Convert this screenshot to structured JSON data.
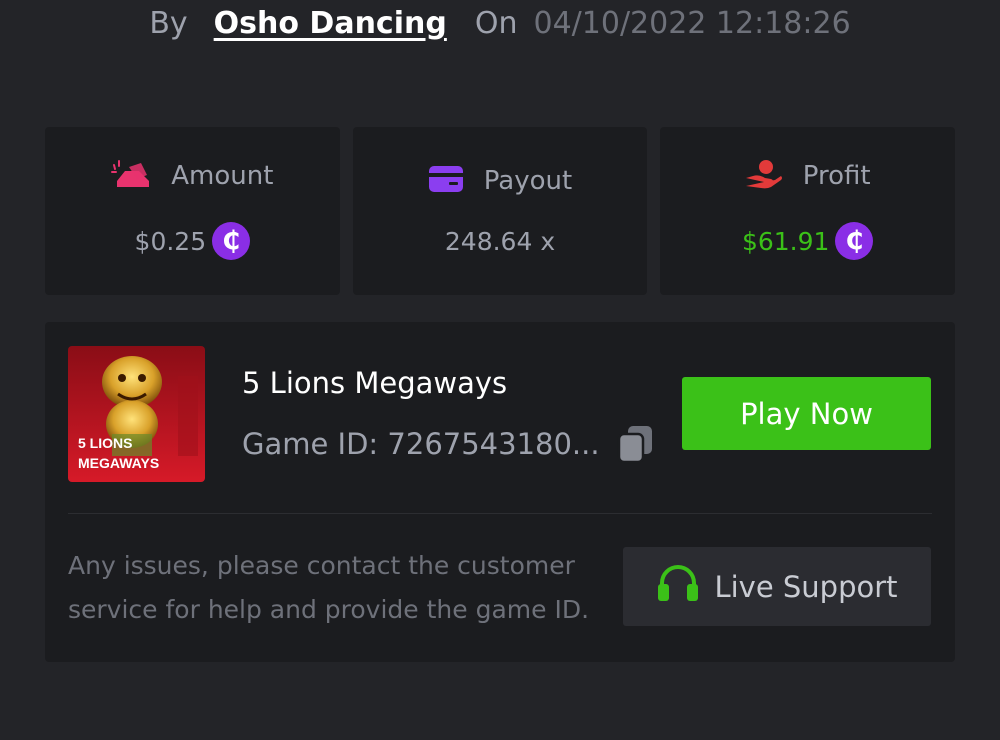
{
  "byline": {
    "by_label": "By",
    "username": "Osho Dancing",
    "on_label": "On",
    "datetime": "04/10/2022 12:18:26"
  },
  "stats": [
    {
      "icon": "bet-amount-icon",
      "label": "Amount",
      "value": "$0.25",
      "coin": "₵",
      "value_color": "#9ea2ad"
    },
    {
      "icon": "card-icon",
      "label": "Payout",
      "value": "248.64 x",
      "value_color": "#9ea2ad"
    },
    {
      "icon": "profit-hand-icon",
      "label": "Profit",
      "value": "$61.91",
      "coin": "₵",
      "value_color": "#3bc118"
    }
  ],
  "game": {
    "title": "5 Lions Megaways",
    "id_text": "Game ID: 7267543180...",
    "thumb_text_line1": "5 LIONS",
    "thumb_text_line2": "MEGAWAYS",
    "play_label": "Play Now"
  },
  "support": {
    "help_text": "Any issues, please contact the customer service for help and provide the game ID.",
    "button_label": "Live Support"
  },
  "colors": {
    "background": "#232428",
    "card": "#1b1c1f",
    "accent_green": "#3bc118",
    "coin_purple": "#8a2ee6",
    "amount_icon_pink": "#e8336e",
    "payout_icon_purple": "#8b3ef0",
    "profit_icon_red": "#e23a3a"
  }
}
